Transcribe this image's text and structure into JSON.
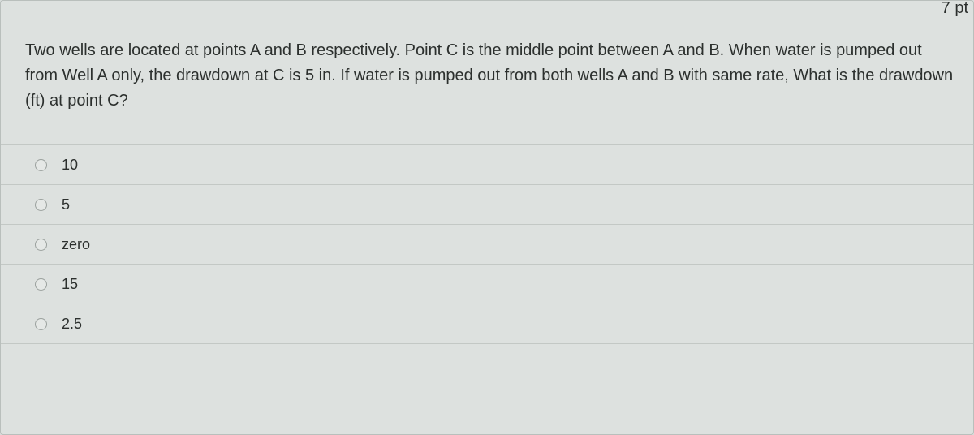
{
  "points_label": "7 pt",
  "question_text": "Two wells are located at points A and B respectively. Point C is the middle point between A and B. When water is pumped out from Well A only, the drawdown at C is 5 in.  If water is pumped out from both wells A and B with same rate, What is the drawdown (ft) at point C?",
  "options": [
    {
      "label": "10"
    },
    {
      "label": "5"
    },
    {
      "label": "zero"
    },
    {
      "label": "15"
    },
    {
      "label": "2.5"
    }
  ]
}
